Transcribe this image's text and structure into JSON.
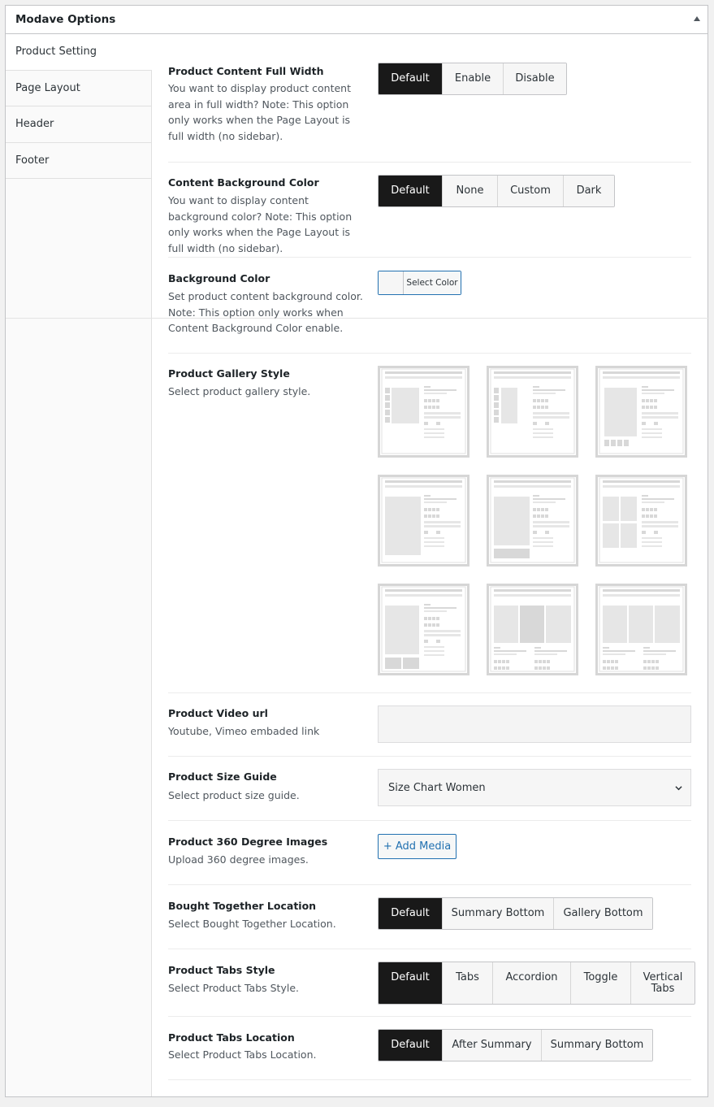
{
  "panel": {
    "title": "Modave Options"
  },
  "sidebar": {
    "items": [
      {
        "label": "Product Setting"
      },
      {
        "label": "Page Layout"
      },
      {
        "label": "Header"
      },
      {
        "label": "Footer"
      }
    ]
  },
  "fields": {
    "content_full_width": {
      "label": "Product Content Full Width",
      "desc": "You want to display product content area in full width? Note: This option only works when the Page Layout is full width (no sidebar).",
      "options": [
        "Default",
        "Enable",
        "Disable"
      ],
      "selected": "Default"
    },
    "content_bg_color": {
      "label": "Content Background Color",
      "desc": "You want to display content background color? Note: This option only works when the Page Layout is full width (no sidebar).",
      "options": [
        "Default",
        "None",
        "Custom",
        "Dark"
      ],
      "selected": "Default"
    },
    "background_color": {
      "label": "Background Color",
      "desc": "Set product content background color. Note: This option only works when Content Background Color enable.",
      "button_label": "Select Color"
    },
    "gallery_style": {
      "label": "Product Gallery Style",
      "desc": "Select product gallery style.",
      "styles": [
        "left-thumbs",
        "left-thumbs-narrow",
        "bottom-thumbs",
        "no-thumbs",
        "bottom-wide",
        "grid-2x2",
        "grid-bottom",
        "slider-center",
        "slider-wide"
      ]
    },
    "video_url": {
      "label": "Product Video url",
      "desc": "Youtube, Vimeo embaded link",
      "value": ""
    },
    "size_guide": {
      "label": "Product Size Guide",
      "desc": "Select product size guide.",
      "selected": "Size Chart Women"
    },
    "images_360": {
      "label": "Product 360 Degree Images",
      "desc": "Upload 360 degree images.",
      "button_label": "+ Add Media"
    },
    "bought_together": {
      "label": "Bought Together Location",
      "desc": "Select Bought Together Location.",
      "options": [
        "Default",
        "Summary Bottom",
        "Gallery Bottom"
      ],
      "selected": "Default"
    },
    "tabs_style": {
      "label": "Product Tabs Style",
      "desc": "Select Product Tabs Style.",
      "options": [
        "Default",
        "Tabs",
        "Accordion",
        "Toggle",
        "Vertical Tabs"
      ],
      "selected": "Default"
    },
    "tabs_location": {
      "label": "Product Tabs Location",
      "desc": "Select Product Tabs Location.",
      "options": [
        "Default",
        "After Summary",
        "Summary Bottom"
      ],
      "selected": "Default"
    }
  },
  "colors": {
    "active_button": "#191919",
    "link_blue": "#2271b1"
  }
}
